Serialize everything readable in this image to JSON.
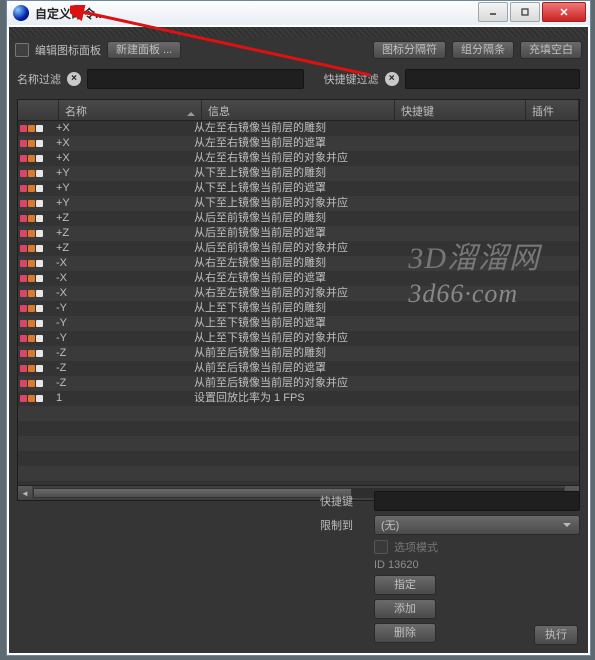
{
  "window": {
    "title": "自定义命令..."
  },
  "toolbar": {
    "edit_palette_label": "编辑图标面板",
    "new_panel_label": "新建面板 ...",
    "icon_sep_label": "图标分隔符",
    "group_sep_label": "组分隔条",
    "fill_blank_label": "充填空白"
  },
  "filters": {
    "name_filter_label": "名称过滤",
    "name_filter_value": "",
    "shortcut_filter_label": "快捷键过滤",
    "shortcut_filter_value": ""
  },
  "table": {
    "headers": {
      "name": "名称",
      "info": "信息",
      "shortcut": "快捷键",
      "plugin": "插件"
    },
    "rows": [
      {
        "name": "+X",
        "info": "从左至右镜像当前层的雕刻"
      },
      {
        "name": "+X",
        "info": "从左至右镜像当前层的遮罩"
      },
      {
        "name": "+X",
        "info": "从左至右镜像当前层的对象并应"
      },
      {
        "name": "+Y",
        "info": "从下至上镜像当前层的雕刻"
      },
      {
        "name": "+Y",
        "info": "从下至上镜像当前层的遮罩"
      },
      {
        "name": "+Y",
        "info": "从下至上镜像当前层的对象并应"
      },
      {
        "name": "+Z",
        "info": "从后至前镜像当前层的雕刻"
      },
      {
        "name": "+Z",
        "info": "从后至前镜像当前层的遮罩"
      },
      {
        "name": "+Z",
        "info": "从后至前镜像当前层的对象并应"
      },
      {
        "name": "-X",
        "info": "从右至左镜像当前层的雕刻"
      },
      {
        "name": "-X",
        "info": "从右至左镜像当前层的遮罩"
      },
      {
        "name": "-X",
        "info": "从右至左镜像当前层的对象并应"
      },
      {
        "name": "-Y",
        "info": "从上至下镜像当前层的雕刻"
      },
      {
        "name": "-Y",
        "info": "从上至下镜像当前层的遮罩"
      },
      {
        "name": "-Y",
        "info": "从上至下镜像当前层的对象并应"
      },
      {
        "name": "-Z",
        "info": "从前至后镜像当前层的雕刻"
      },
      {
        "name": "-Z",
        "info": "从前至后镜像当前层的遮罩"
      },
      {
        "name": "-Z",
        "info": "从前至后镜像当前层的对象并应"
      },
      {
        "name": "1",
        "info": "设置回放比率为 1 FPS"
      }
    ]
  },
  "detail": {
    "shortcut_label": "快捷键",
    "shortcut_value": "",
    "restrict_label": "限制到",
    "restrict_value": "(无)",
    "option_mode_label": "选项模式",
    "id_label": "ID 13620",
    "assign_label": "指定",
    "add_label": "添加",
    "delete_label": "删除",
    "execute_label": "执行"
  },
  "watermark": {
    "line1": "3D溜溜网",
    "line2": "3d66·com"
  }
}
